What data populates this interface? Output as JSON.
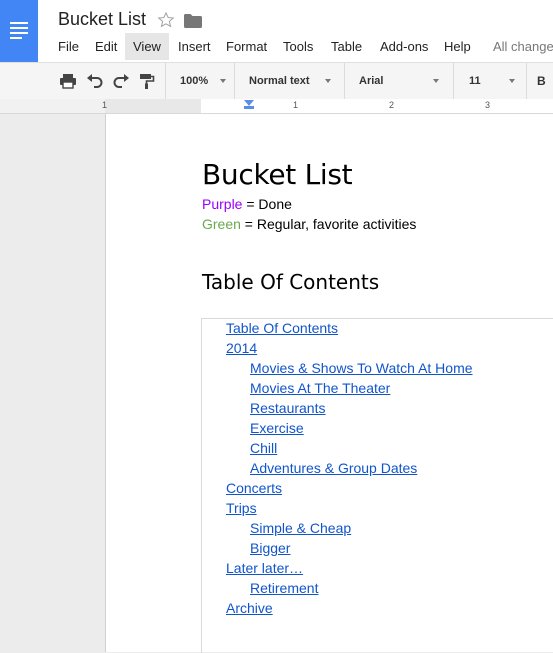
{
  "doc": {
    "title": "Bucket List"
  },
  "menu": {
    "items": [
      "File",
      "Edit",
      "View",
      "Insert",
      "Format",
      "Tools",
      "Table",
      "Add-ons",
      "Help"
    ],
    "saved_status": "All change"
  },
  "toolbar": {
    "zoom": "100%",
    "style": "Normal text",
    "font": "Arial",
    "size": "11",
    "bold": "B"
  },
  "ruler": {
    "numbers": [
      "1",
      "1",
      "2",
      "3"
    ]
  },
  "content": {
    "heading": "Bucket List",
    "legend": [
      {
        "color_word": "Purple",
        "color": "#9900ff",
        "rest": " = Done"
      },
      {
        "color_word": "Green",
        "color": "#6aa84f",
        "rest": " = Regular, favorite activities"
      }
    ],
    "toc_heading": "Table Of Contents",
    "toc": [
      {
        "text": "Table Of Contents",
        "level": 0
      },
      {
        "text": "2014",
        "level": 0
      },
      {
        "text": "Movies & Shows To Watch At Home",
        "level": 1
      },
      {
        "text": "Movies At The Theater",
        "level": 1
      },
      {
        "text": "Restaurants",
        "level": 1
      },
      {
        "text": "Exercise",
        "level": 1
      },
      {
        "text": "Chill",
        "level": 1
      },
      {
        "text": "Adventures & Group Dates",
        "level": 1
      },
      {
        "text": "Concerts",
        "level": 0
      },
      {
        "text": "Trips",
        "level": 0
      },
      {
        "text": "Simple & Cheap",
        "level": 1
      },
      {
        "text": "Bigger",
        "level": 1
      },
      {
        "text": "Later later…",
        "level": 0
      },
      {
        "text": "Retirement",
        "level": 1
      },
      {
        "text": "Archive",
        "level": 0
      }
    ]
  },
  "colors": {
    "brand": "#4285f4",
    "link": "#1155cc",
    "done": "#9900ff",
    "regular": "#6aa84f"
  }
}
